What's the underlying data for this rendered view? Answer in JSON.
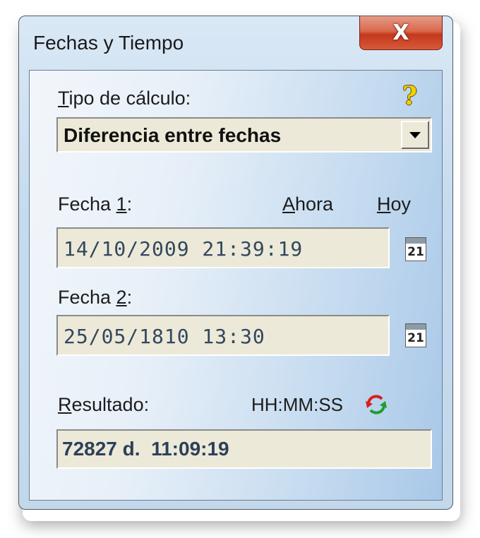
{
  "window": {
    "title": "Fechas y Tiempo",
    "close_label": "X"
  },
  "calc_type": {
    "label_prefix": "",
    "label_mnemonic": "T",
    "label_rest": "ipo de cálculo:",
    "selected": "Diferencia entre fechas"
  },
  "fecha1": {
    "label_prefix": "Fecha ",
    "label_mnemonic": "1",
    "label_rest": ":",
    "now_mnemonic": "A",
    "now_rest": "hora",
    "today_mnemonic": "H",
    "today_rest": "oy",
    "value": "14/10/2009 21:39:19",
    "calendar_icon_text": "21"
  },
  "fecha2": {
    "label_prefix": "Fecha ",
    "label_mnemonic": "2",
    "label_rest": ":",
    "value": "25/05/1810 13:30",
    "calendar_icon_text": "21"
  },
  "resultado": {
    "label_mnemonic": "R",
    "label_rest": "esultado:",
    "format": "HH:MM:SS",
    "value": "72827 d.  11:09:19"
  },
  "icons": {
    "help": "?",
    "close": "close-icon",
    "calendar": "calendar-icon",
    "refresh": "refresh-icon"
  }
}
